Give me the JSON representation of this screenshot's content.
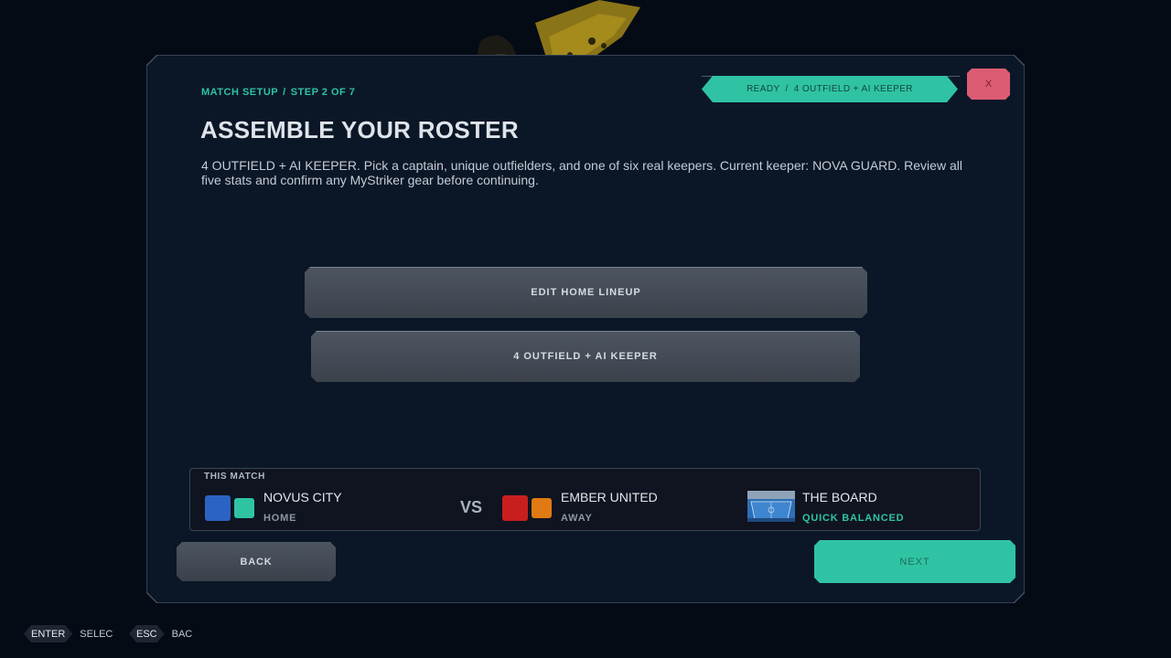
{
  "header": {
    "breadcrumb": [
      "MATCH SETUP",
      "STEP 2 OF 7"
    ],
    "breadcrumb_sep": "/",
    "title": "ASSEMBLE YOUR ROSTER",
    "description": "4 OUTFIELD + AI KEEPER. Pick a captain, unique outfielders, and one of six real keepers. Current keeper: NOVA GUARD. Review all five stats and confirm any MyStriker gear before continuing."
  },
  "status": {
    "state": "READY",
    "sep": "/",
    "format": "4 OUTFIELD + AI KEEPER",
    "close_label": "X"
  },
  "actions": {
    "edit_lineup": "EDIT HOME LINEUP",
    "format_button": "4 OUTFIELD + AI KEEPER",
    "back": "BACK",
    "next": "NEXT"
  },
  "match": {
    "label": "THIS MATCH",
    "vs": "VS",
    "home": {
      "name": "NOVUS CITY",
      "role": "HOME",
      "colors": [
        "#2b63c4",
        "#2fc3a4"
      ]
    },
    "away": {
      "name": "EMBER UNITED",
      "role": "AWAY",
      "colors": [
        "#c81e1e",
        "#e07a12"
      ]
    },
    "venue": {
      "name": "THE BOARD",
      "mode": "QUICK BALANCED",
      "thumb_icon": "stadium-thumbnail"
    }
  },
  "footer_hints": [
    {
      "key": "ENTER",
      "action": "SELEC"
    },
    {
      "key": "ESC",
      "action": "BAC"
    }
  ],
  "colors": {
    "accent": "#2fc3a4",
    "danger": "#dc5c74",
    "panel_bg": "#0b1727"
  }
}
